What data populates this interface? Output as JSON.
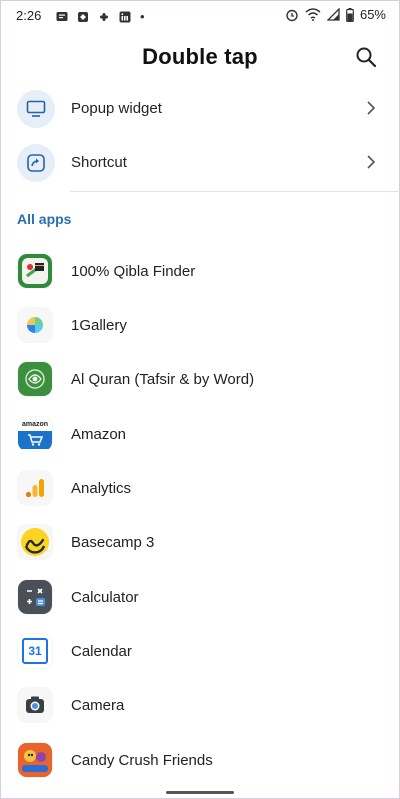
{
  "status_bar": {
    "time": "2:26",
    "dot": "•",
    "battery_percent": "65%",
    "icons": [
      "message-icon",
      "slack-icon",
      "slack-icon",
      "linkedin-icon",
      "alarm-icon",
      "wifi-icon",
      "signal-icon",
      "battery-icon"
    ]
  },
  "header": {
    "title": "Double tap",
    "search_icon": "search-icon"
  },
  "options": [
    {
      "label": "Popup widget",
      "icon": "monitor-icon"
    },
    {
      "label": "Shortcut",
      "icon": "shortcut-arrow-icon"
    }
  ],
  "section_title": "All apps",
  "apps": [
    {
      "name": "100% Qibla Finder",
      "icon": "qibla-finder-icon"
    },
    {
      "name": "1Gallery",
      "icon": "gallery-icon"
    },
    {
      "name": "Al Quran (Tafsir & by Word)",
      "icon": "quran-icon"
    },
    {
      "name": "Amazon",
      "icon": "amazon-icon",
      "icon_text": "amazon"
    },
    {
      "name": "Analytics",
      "icon": "analytics-icon"
    },
    {
      "name": "Basecamp 3",
      "icon": "basecamp-icon"
    },
    {
      "name": "Calculator",
      "icon": "calculator-icon"
    },
    {
      "name": "Calendar",
      "icon": "calendar-icon",
      "icon_text": "31"
    },
    {
      "name": "Camera",
      "icon": "camera-icon"
    },
    {
      "name": "Candy Crush Friends",
      "icon": "candy-crush-icon"
    }
  ],
  "colors": {
    "accent": "#2a6fb0",
    "option_bg": "#e6eef7",
    "icon_blue": "#2563a8"
  }
}
